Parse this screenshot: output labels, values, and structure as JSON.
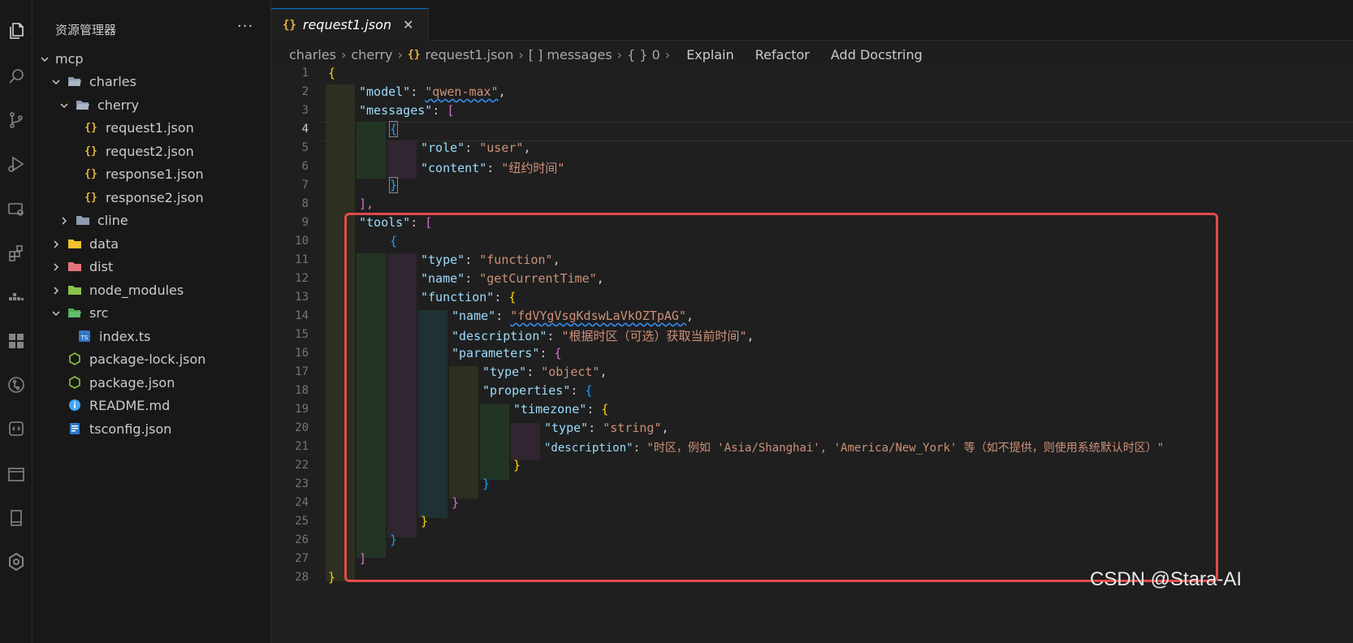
{
  "sidebar": {
    "title": "资源管理器",
    "more": "···",
    "tree": [
      {
        "label": "mcp",
        "type": "root"
      },
      {
        "label": "charles",
        "type": "folder-open"
      },
      {
        "label": "cherry",
        "type": "folder-open"
      },
      {
        "label": "request1.json",
        "type": "json"
      },
      {
        "label": "request2.json",
        "type": "json"
      },
      {
        "label": "response1.json",
        "type": "json"
      },
      {
        "label": "response2.json",
        "type": "json"
      },
      {
        "label": "cline",
        "type": "folder"
      },
      {
        "label": "data",
        "type": "folder"
      },
      {
        "label": "dist",
        "type": "folder"
      },
      {
        "label": "node_modules",
        "type": "folder"
      },
      {
        "label": "src",
        "type": "folder-open"
      },
      {
        "label": "index.ts",
        "type": "ts"
      },
      {
        "label": "package-lock.json",
        "type": "node"
      },
      {
        "label": "package.json",
        "type": "node"
      },
      {
        "label": "README.md",
        "type": "info"
      },
      {
        "label": "tsconfig.json",
        "type": "tsconfig"
      }
    ]
  },
  "tab": {
    "icon": "{}",
    "label": "request1.json",
    "close": "✕"
  },
  "breadcrumb": {
    "parts": [
      "charles",
      "cherry",
      "request1.json",
      "[ ] messages",
      "{ } 0"
    ],
    "json_icon": "{}",
    "lenses": [
      "Explain",
      "Refactor",
      "Add Docstring"
    ]
  },
  "editor": {
    "current_line": 4,
    "line_numbers": [
      "1",
      "2",
      "3",
      "4",
      "5",
      "6",
      "7",
      "8",
      "9",
      "10",
      "11",
      "12",
      "13",
      "14",
      "15",
      "16",
      "17",
      "18",
      "19",
      "20",
      "21",
      "22",
      "23",
      "24",
      "25",
      "26",
      "27",
      "28"
    ],
    "tokens": {
      "l1_b": "{",
      "l2_k": "\"model\"",
      "l2_v": "\"qwen-max\"",
      "l3_k": "\"messages\"",
      "l3_b": "[",
      "l4_b": "{",
      "l5_k": "\"role\"",
      "l5_v": "\"user\"",
      "l6_k": "\"content\"",
      "l6_v": "\"纽约时间\"",
      "l7_b": "}",
      "l8_b": "],",
      "l9_k": "\"tools\"",
      "l9_b": "[",
      "l10_b": "{",
      "l11_k": "\"type\"",
      "l11_v": "\"function\"",
      "l12_k": "\"name\"",
      "l12_v": "\"getCurrentTime\"",
      "l13_k": "\"function\"",
      "l13_b": "{",
      "l14_k": "\"name\"",
      "l14_v": "\"fdVYgVsgKdswLaVkOZTpAG\"",
      "l15_k": "\"description\"",
      "l15_v": "\"根据时区（可选）获取当前时间\"",
      "l16_k": "\"parameters\"",
      "l16_b": "{",
      "l17_k": "\"type\"",
      "l17_v": "\"object\"",
      "l18_k": "\"properties\"",
      "l18_b": "{",
      "l19_k": "\"timezone\"",
      "l19_b": "{",
      "l20_k": "\"type\"",
      "l20_v": "\"string\"",
      "l21_k": "\"description\"",
      "l21_v": "\"时区，例如 'Asia/Shanghai', 'America/New_York' 等（如不提供，则使用系统默认时区）\"",
      "l22_b": "}",
      "l23_b": "}",
      "l24_b": "}",
      "l25_b": "}",
      "l26_b": "}",
      "l27_b": "]",
      "l28_b": "}"
    }
  },
  "watermark": "CSDN @Stara-AI",
  "colors": {
    "accent": "#0078d4",
    "highlight_box": "#e24a4a",
    "json_icon": "#e8b73d"
  }
}
